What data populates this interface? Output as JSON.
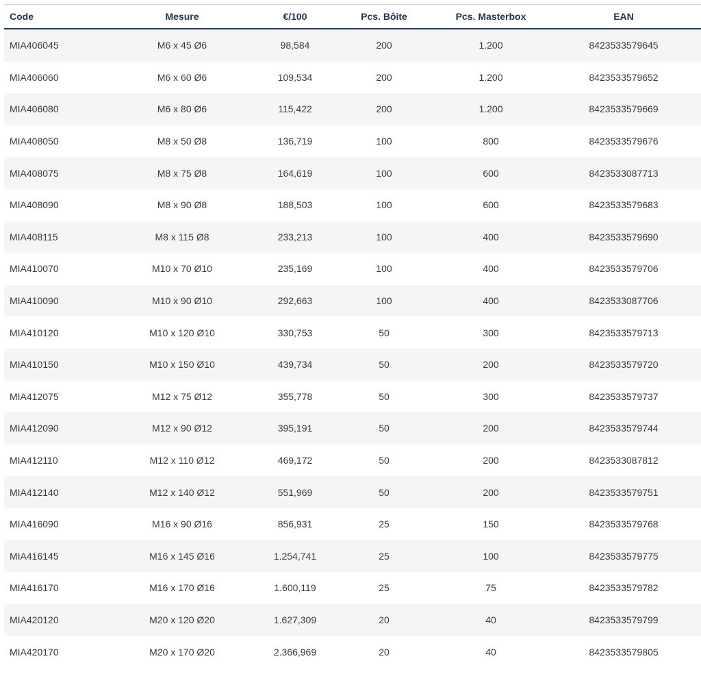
{
  "table": {
    "headers": [
      "Code",
      "Mesure",
      "€/100",
      "Pcs. Bôite",
      "Pcs. Masterbox",
      "EAN"
    ],
    "rows": [
      [
        "MIA406045",
        "M6 x 45 Ø6",
        "98,584",
        "200",
        "1.200",
        "8423533579645"
      ],
      [
        "MIA406060",
        "M6 x 60 Ø6",
        "109,534",
        "200",
        "1.200",
        "8423533579652"
      ],
      [
        "MIA406080",
        "M6 x 80 Ø6",
        "115,422",
        "200",
        "1.200",
        "8423533579669"
      ],
      [
        "MIA408050",
        "M8 x 50 Ø8",
        "136,719",
        "100",
        "800",
        "8423533579676"
      ],
      [
        "MIA408075",
        "M8 x 75 Ø8",
        "164,619",
        "100",
        "600",
        "8423533087713"
      ],
      [
        "MIA408090",
        "M8 x 90 Ø8",
        "188,503",
        "100",
        "600",
        "8423533579683"
      ],
      [
        "MIA408115",
        "M8 x 115 Ø8",
        "233,213",
        "100",
        "400",
        "8423533579690"
      ],
      [
        "MIA410070",
        "M10 x 70 Ø10",
        "235,169",
        "100",
        "400",
        "8423533579706"
      ],
      [
        "MIA410090",
        "M10 x 90 Ø10",
        "292,663",
        "100",
        "400",
        "8423533087706"
      ],
      [
        "MIA410120",
        "M10 x 120 Ø10",
        "330,753",
        "50",
        "300",
        "8423533579713"
      ],
      [
        "MIA410150",
        "M10 x 150 Ø10",
        "439,734",
        "50",
        "200",
        "8423533579720"
      ],
      [
        "MIA412075",
        "M12 x 75 Ø12",
        "355,778",
        "50",
        "300",
        "8423533579737"
      ],
      [
        "MIA412090",
        "M12 x 90 Ø12",
        "395,191",
        "50",
        "200",
        "8423533579744"
      ],
      [
        "MIA412110",
        "M12 x 110 Ø12",
        "469,172",
        "50",
        "200",
        "8423533087812"
      ],
      [
        "MIA412140",
        "M12 x 140 Ø12",
        "551,969",
        "50",
        "200",
        "8423533579751"
      ],
      [
        "MIA416090",
        "M16 x 90 Ø16",
        "856,931",
        "25",
        "150",
        "8423533579768"
      ],
      [
        "MIA416145",
        "M16 x 145 Ø16",
        "1.254,741",
        "25",
        "100",
        "8423533579775"
      ],
      [
        "MIA416170",
        "M16 x 170 Ø16",
        "1.600,119",
        "25",
        "75",
        "8423533579782"
      ],
      [
        "MIA420120",
        "M20 x 120 Ø20",
        "1.627,309",
        "20",
        "40",
        "8423533579799"
      ],
      [
        "MIA420170",
        "M20 x 170 Ø20",
        "2.366,969",
        "20",
        "40",
        "8423533579805"
      ]
    ]
  },
  "colors": {
    "header_text": "#1f3350",
    "header_rule": "#243a5e",
    "row_stripe": "#f5f5f5",
    "body_text": "#3a3a3a"
  }
}
